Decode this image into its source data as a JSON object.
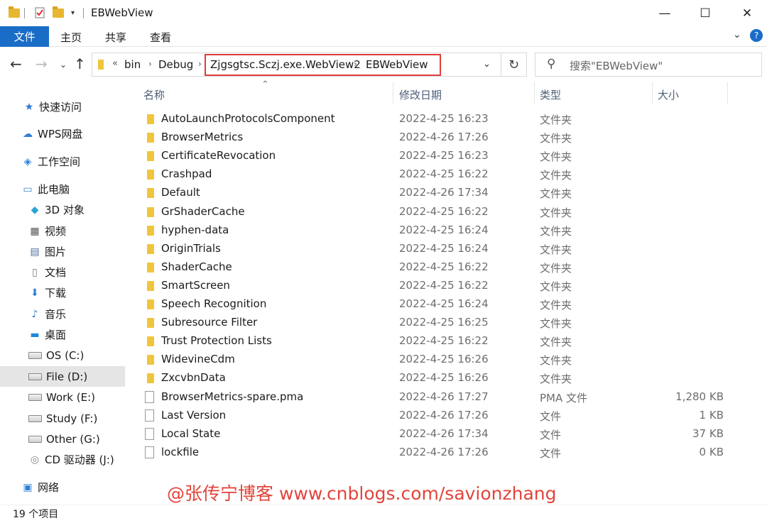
{
  "window": {
    "title": "EBWebView",
    "minimize": "—",
    "maximize": "☐",
    "close": "✕"
  },
  "ribbon": {
    "file_tab": "文件",
    "tabs": [
      "主页",
      "共享",
      "查看"
    ],
    "collapse": "⌄",
    "help": "?"
  },
  "address": {
    "overflow": "«",
    "crumbs": [
      "bin",
      "Debug",
      "Zjgsgtsc.Sczj.exe.WebView2",
      "EBWebView"
    ],
    "search_placeholder": "搜索\"EBWebView\""
  },
  "sidebar": {
    "items": [
      {
        "label": "快速访问",
        "icon": "star-icon"
      },
      {
        "label": "WPS网盘",
        "icon": "cloud-icon"
      },
      {
        "label": "工作空间",
        "icon": "workspace-icon"
      },
      {
        "label": "此电脑",
        "icon": "computer-icon"
      },
      {
        "label": "3D 对象",
        "icon": "cube-icon"
      },
      {
        "label": "视频",
        "icon": "video-icon"
      },
      {
        "label": "图片",
        "icon": "picture-icon"
      },
      {
        "label": "文档",
        "icon": "document-icon"
      },
      {
        "label": "下载",
        "icon": "download-icon"
      },
      {
        "label": "音乐",
        "icon": "music-icon"
      },
      {
        "label": "桌面",
        "icon": "desktop-icon"
      },
      {
        "label": "OS (C:)",
        "icon": "drive-icon"
      },
      {
        "label": "File (D:)",
        "icon": "drive-icon"
      },
      {
        "label": "Work (E:)",
        "icon": "drive-icon"
      },
      {
        "label": "Study (F:)",
        "icon": "drive-icon"
      },
      {
        "label": "Other (G:)",
        "icon": "drive-icon"
      },
      {
        "label": "CD 驱动器 (J:)",
        "icon": "cd-drive-icon"
      },
      {
        "label": "网络",
        "icon": "network-icon"
      }
    ]
  },
  "columns": {
    "name": "名称",
    "date": "修改日期",
    "type": "类型",
    "size": "大小"
  },
  "files": [
    {
      "name": "AutoLaunchProtocolsComponent",
      "date": "2022-4-25 16:23",
      "type": "文件夹",
      "size": "",
      "kind": "folder"
    },
    {
      "name": "BrowserMetrics",
      "date": "2022-4-26 17:26",
      "type": "文件夹",
      "size": "",
      "kind": "folder"
    },
    {
      "name": "CertificateRevocation",
      "date": "2022-4-25 16:23",
      "type": "文件夹",
      "size": "",
      "kind": "folder"
    },
    {
      "name": "Crashpad",
      "date": "2022-4-25 16:22",
      "type": "文件夹",
      "size": "",
      "kind": "folder"
    },
    {
      "name": "Default",
      "date": "2022-4-26 17:34",
      "type": "文件夹",
      "size": "",
      "kind": "folder"
    },
    {
      "name": "GrShaderCache",
      "date": "2022-4-25 16:22",
      "type": "文件夹",
      "size": "",
      "kind": "folder"
    },
    {
      "name": "hyphen-data",
      "date": "2022-4-25 16:24",
      "type": "文件夹",
      "size": "",
      "kind": "folder"
    },
    {
      "name": "OriginTrials",
      "date": "2022-4-25 16:24",
      "type": "文件夹",
      "size": "",
      "kind": "folder"
    },
    {
      "name": "ShaderCache",
      "date": "2022-4-25 16:22",
      "type": "文件夹",
      "size": "",
      "kind": "folder"
    },
    {
      "name": "SmartScreen",
      "date": "2022-4-25 16:22",
      "type": "文件夹",
      "size": "",
      "kind": "folder"
    },
    {
      "name": "Speech Recognition",
      "date": "2022-4-25 16:24",
      "type": "文件夹",
      "size": "",
      "kind": "folder"
    },
    {
      "name": "Subresource Filter",
      "date": "2022-4-25 16:25",
      "type": "文件夹",
      "size": "",
      "kind": "folder"
    },
    {
      "name": "Trust Protection Lists",
      "date": "2022-4-25 16:22",
      "type": "文件夹",
      "size": "",
      "kind": "folder"
    },
    {
      "name": "WidevineCdm",
      "date": "2022-4-25 16:26",
      "type": "文件夹",
      "size": "",
      "kind": "folder"
    },
    {
      "name": "ZxcvbnData",
      "date": "2022-4-25 16:26",
      "type": "文件夹",
      "size": "",
      "kind": "folder"
    },
    {
      "name": "BrowserMetrics-spare.pma",
      "date": "2022-4-26 17:27",
      "type": "PMA 文件",
      "size": "1,280 KB",
      "kind": "file"
    },
    {
      "name": "Last Version",
      "date": "2022-4-26 17:26",
      "type": "文件",
      "size": "1 KB",
      "kind": "file"
    },
    {
      "name": "Local State",
      "date": "2022-4-26 17:34",
      "type": "文件",
      "size": "37 KB",
      "kind": "file"
    },
    {
      "name": "lockfile",
      "date": "2022-4-26 17:26",
      "type": "文件",
      "size": "0 KB",
      "kind": "file"
    }
  ],
  "status": {
    "count": "19 个项目"
  },
  "watermark": "@张传宁博客 www.cnblogs.com/savionzhang"
}
